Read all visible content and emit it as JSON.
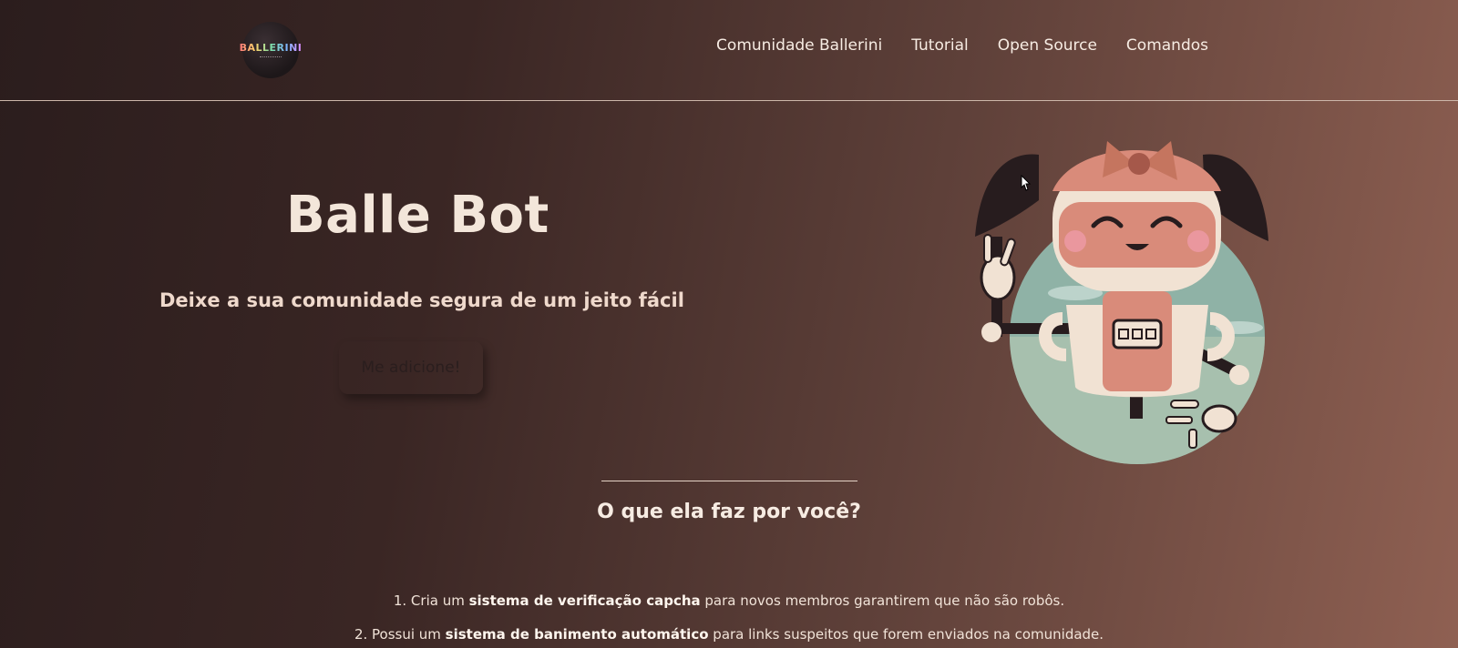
{
  "header": {
    "logo_text": "BALLERINI",
    "nav": [
      "Comunidade Ballerini",
      "Tutorial",
      "Open Source",
      "Comandos"
    ]
  },
  "hero": {
    "title": "Balle Bot",
    "subtitle": "Deixe a sua comunidade segura de um jeito fácil",
    "cta_label": "Me adicione!"
  },
  "features": {
    "heading": "O que ela faz por você?",
    "items": [
      {
        "pre": "1. Cria um ",
        "bold": "sistema de verificação capcha",
        "post": " para novos membros garantirem que não são robôs."
      },
      {
        "pre": "2. Possui um ",
        "bold": "sistema de banimento automático",
        "post": " para links suspeitos que forem enviados na comunidade."
      }
    ]
  },
  "colors": {
    "bg_start": "#2b1d1d",
    "bg_end": "#8f6052",
    "text": "#f3e6da",
    "robot_pink": "#d98b7a",
    "robot_cream": "#f1e2d3"
  }
}
